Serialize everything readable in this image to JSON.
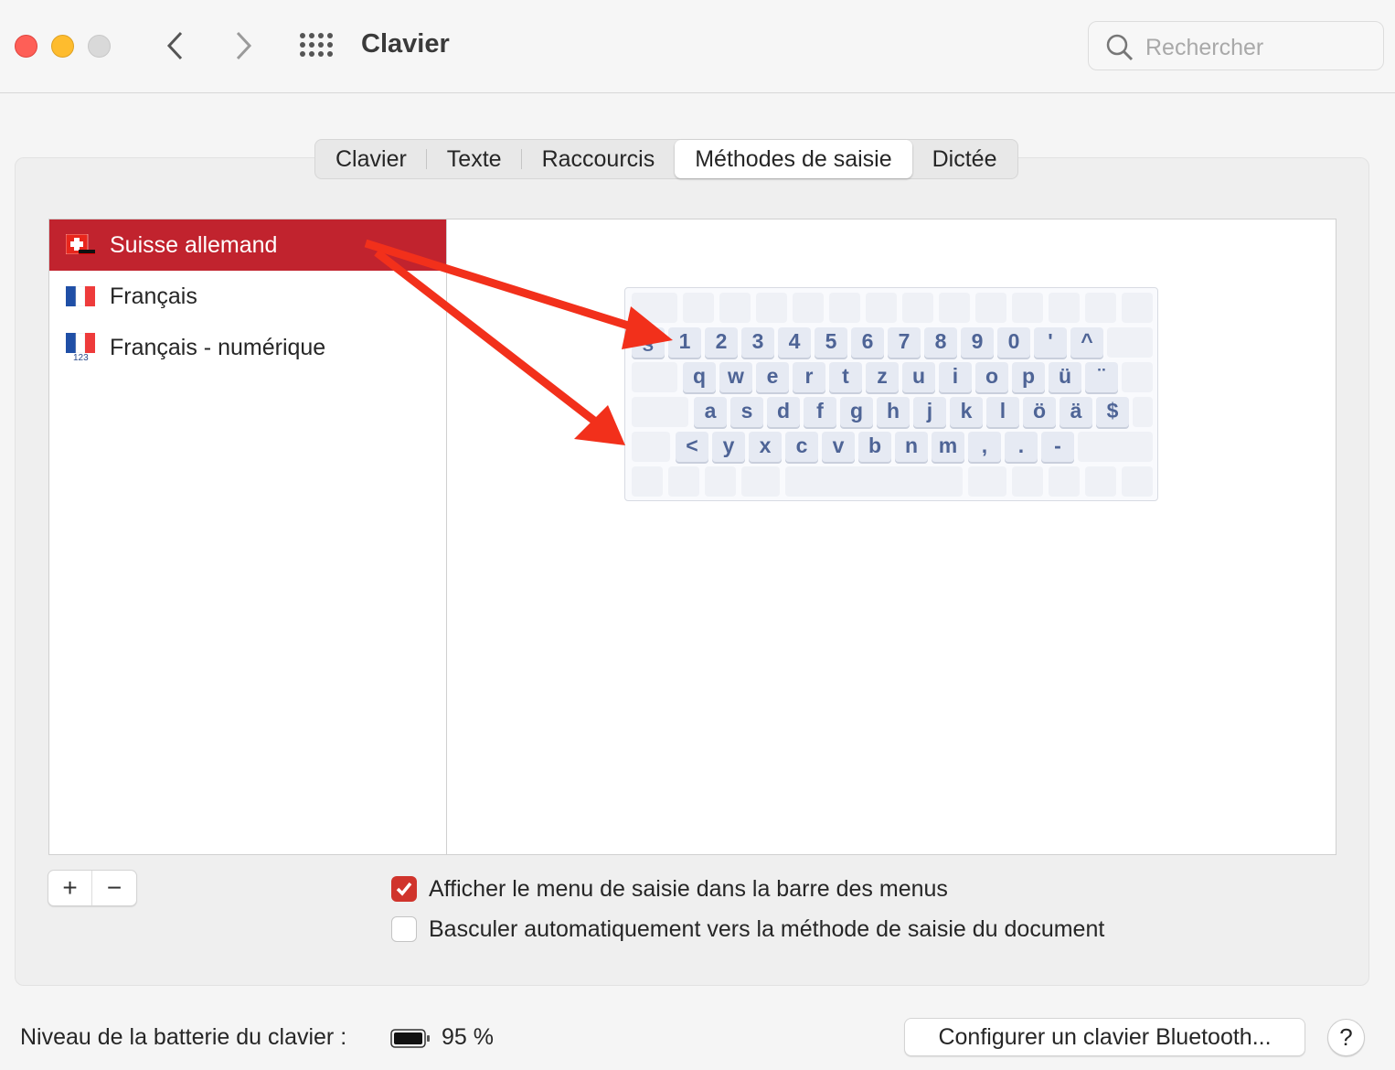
{
  "window": {
    "title": "Clavier",
    "search_placeholder": "Rechercher"
  },
  "tabs": [
    {
      "label": "Clavier",
      "active": false
    },
    {
      "label": "Texte",
      "active": false
    },
    {
      "label": "Raccourcis",
      "active": false
    },
    {
      "label": "Méthodes de saisie",
      "active": true
    },
    {
      "label": "Dictée",
      "active": false
    }
  ],
  "input_sources": [
    {
      "label": "Suisse allemand",
      "flag": "swiss-german-flag",
      "selected": true
    },
    {
      "label": "Français",
      "flag": "french-flag",
      "selected": false
    },
    {
      "label": "Français - numérique",
      "flag": "french-numeric-flag",
      "flag_caption": "123",
      "selected": false
    }
  ],
  "keyboard_rows": [
    [
      "§",
      "1",
      "2",
      "3",
      "4",
      "5",
      "6",
      "7",
      "8",
      "9",
      "0",
      "'",
      "^"
    ],
    [
      "q",
      "w",
      "e",
      "r",
      "t",
      "z",
      "u",
      "i",
      "o",
      "p",
      "ü",
      "¨"
    ],
    [
      "a",
      "s",
      "d",
      "f",
      "g",
      "h",
      "j",
      "k",
      "l",
      "ö",
      "ä",
      "$"
    ],
    [
      "<",
      "y",
      "x",
      "c",
      "v",
      "b",
      "n",
      "m",
      ",",
      ".",
      "-"
    ]
  ],
  "buttons": {
    "add": "+",
    "remove": "−",
    "bluetooth": "Configurer un clavier Bluetooth...",
    "help": "?"
  },
  "options": [
    {
      "label": "Afficher le menu de saisie dans la barre des menus",
      "checked": true
    },
    {
      "label": "Basculer automatiquement vers la méthode de saisie du document",
      "checked": false
    }
  ],
  "battery": {
    "label": "Niveau de la batterie du clavier :",
    "value": "95 %",
    "percent": 95
  },
  "colors": {
    "accent": "#c1232e",
    "checkbox": "#d0342c",
    "arrow": "#f2301b",
    "key_text": "#4e6496"
  }
}
